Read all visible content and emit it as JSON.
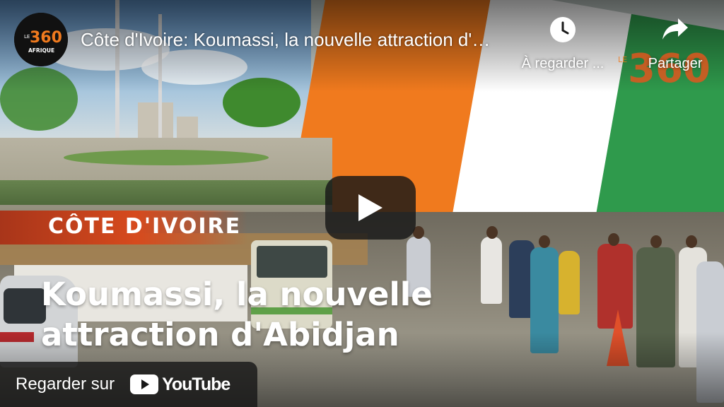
{
  "player": {
    "title": "Côte d'Ivoire: Koumassi, la nouvelle attraction d'Abidjan",
    "channel": {
      "name": "Le360 Afrique",
      "logo_top": "LE",
      "logo_mark": "360",
      "logo_bottom": "AFRIQUE",
      "avatar_icon": "le360-afrique-logo"
    },
    "actions": [
      {
        "label": "À regarder ...",
        "icon": "clock-icon"
      },
      {
        "label": "Partager",
        "icon": "share-arrow-icon"
      }
    ],
    "play_icon": "play-icon",
    "watermark": {
      "top": "LE",
      "mark": "360"
    }
  },
  "thumbnail": {
    "country_tag": "CÔTE D'IVOIRE",
    "headline_line1": "Koumassi, la nouvelle",
    "headline_line2": "attraction d'Abidjan"
  },
  "watch_on": {
    "label": "Regarder sur",
    "platform": "YouTube",
    "icon": "youtube-logo-icon"
  },
  "colors": {
    "brand_orange": "#f07a1e",
    "flag_white": "#ffffff",
    "flag_green": "#2f9a4c",
    "overlay_dark": "#171717",
    "youtube_mark_white": "#ffffff"
  }
}
